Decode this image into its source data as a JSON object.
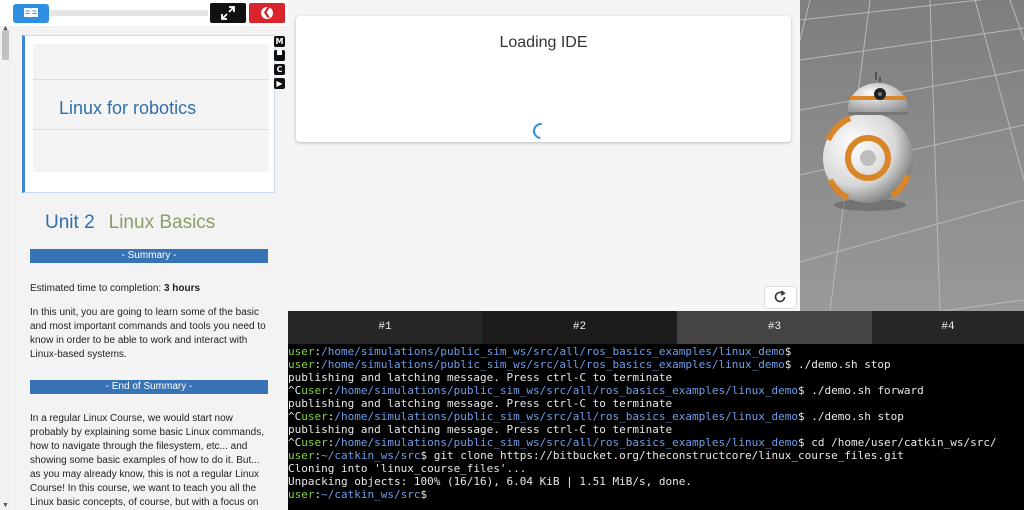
{
  "notebook": {
    "cover_title": "Linux for robotics",
    "side_icons": [
      "M",
      "C"
    ],
    "unit_label": "Unit 2",
    "unit_title": "Linux Basics",
    "summary_band": "- Summary -",
    "estimated_label": "Estimated time to completion: ",
    "estimated_value": "3 hours",
    "intro_paragraph": "In this unit, you are going to learn some of the basic and most important commands and tools you need to know in order to be able to work and interact with Linux-based systems.",
    "end_summary_band": "- End of Summary -",
    "body_lines": [
      "In a regular Linux Course, we would start now",
      "probably by explaining some basic Linux commands,",
      "how to navigate through the filesystem, etc... and",
      "showing some basic examples of how to do it. But...",
      "as you may already know, this is not a regular Linux",
      "Course! In this course, we want to teach you all the",
      "Linux basic concepts, of course, but with a focus on"
    ]
  },
  "ide": {
    "title": "Loading IDE"
  },
  "terminal": {
    "tabs": [
      "#1",
      "#2",
      "#3",
      "#4"
    ],
    "active_tab": "#3",
    "lines": [
      {
        "pre": "",
        "user": "user",
        "sep": ":",
        "path": "/home/simulations/public_sim_ws/src/all/ros_basics_examples/linux_demo",
        "rest": "$"
      },
      {
        "pre": "",
        "user": "user",
        "sep": ":",
        "path": "/home/simulations/public_sim_ws/src/all/ros_basics_examples/linux_demo",
        "rest": "$ ./demo.sh stop"
      },
      {
        "pre": "publishing and latching message. Press ctrl-C to terminate",
        "user": "",
        "sep": "",
        "path": "",
        "rest": ""
      },
      {
        "pre": "^C",
        "user": "user",
        "sep": ":",
        "path": "/home/simulations/public_sim_ws/src/all/ros_basics_examples/linux_demo",
        "rest": "$ ./demo.sh forward"
      },
      {
        "pre": "publishing and latching message. Press ctrl-C to terminate",
        "user": "",
        "sep": "",
        "path": "",
        "rest": ""
      },
      {
        "pre": "^C",
        "user": "user",
        "sep": ":",
        "path": "/home/simulations/public_sim_ws/src/all/ros_basics_examples/linux_demo",
        "rest": "$ ./demo.sh stop"
      },
      {
        "pre": "publishing and latching message. Press ctrl-C to terminate",
        "user": "",
        "sep": "",
        "path": "",
        "rest": ""
      },
      {
        "pre": "^C",
        "user": "user",
        "sep": ":",
        "path": "/home/simulations/public_sim_ws/src/all/ros_basics_examples/linux_demo",
        "rest": "$ cd /home/user/catkin_ws/src/"
      },
      {
        "pre": "",
        "user": "user",
        "sep": ":",
        "path": "~/catkin_ws/src",
        "rest": "$ git clone https://bitbucket.org/theconstructcore/linux_course_files.git"
      },
      {
        "pre": "Cloning into 'linux_course_files'...",
        "user": "",
        "sep": "",
        "path": "",
        "rest": ""
      },
      {
        "pre": "Unpacking objects: 100% (16/16), 6.04 KiB | 1.51 MiB/s, done.",
        "user": "",
        "sep": "",
        "path": "",
        "rest": ""
      },
      {
        "pre": "",
        "user": "user",
        "sep": ":",
        "path": "~/catkin_ws/src",
        "rest": "$"
      }
    ]
  },
  "colors": {
    "accent": "#2e8ee0",
    "band": "#3873b5",
    "prompt_user": "#7fd23a",
    "prompt_path": "#6e9ee9"
  }
}
